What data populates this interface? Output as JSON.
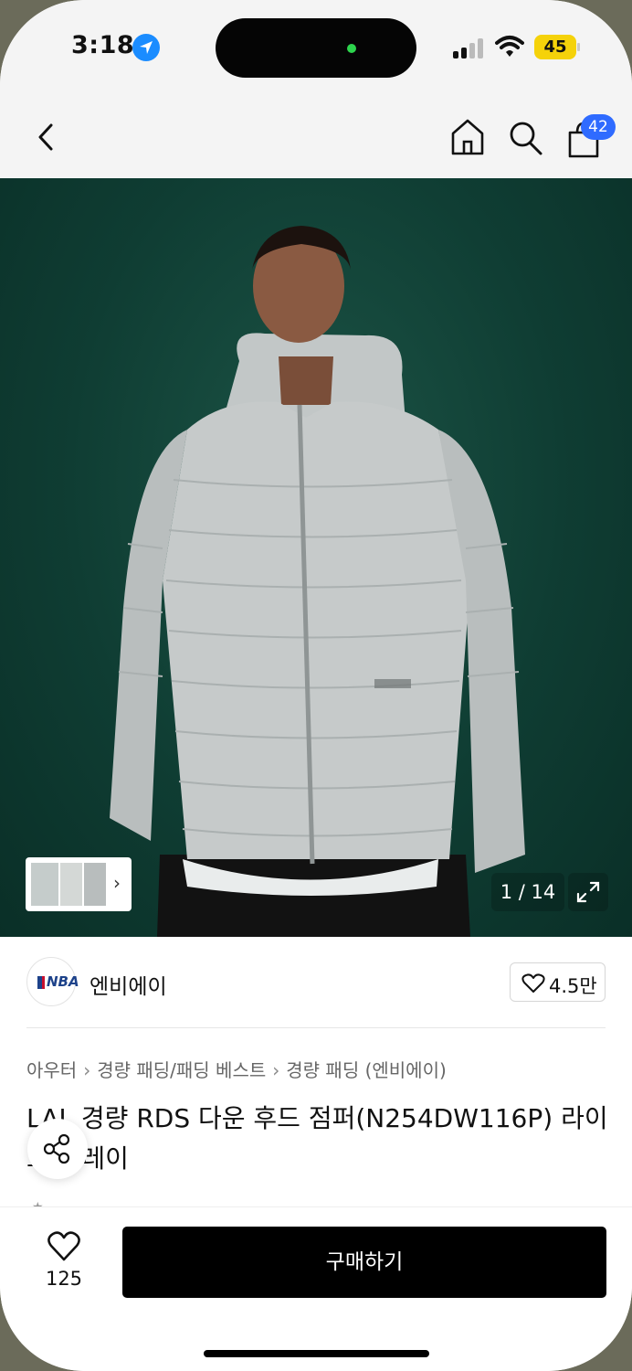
{
  "status_bar": {
    "time": "3:18",
    "battery": "45"
  },
  "nav": {
    "cart_count": "42"
  },
  "gallery": {
    "counter": "1 / 14"
  },
  "brand": {
    "name": "엔비에이",
    "logo_text": "NBA",
    "likes": "4.5만"
  },
  "breadcrumb": [
    "아우터",
    "경량 패딩/패딩 베스트",
    "경량 패딩 (엔비에이)"
  ],
  "product": {
    "title": "LAL 경량 RDS 다운 후드 점퍼(N254DW116P) 라이트 그레이"
  },
  "bottom_bar": {
    "wish_count": "125",
    "buy_label": "구매하기"
  },
  "colors": {
    "accent": "#2f6bff",
    "buy_button": "#000000",
    "hero_background": "#0f3d33"
  },
  "icons": [
    "location-arrow-icon",
    "back-icon",
    "home-icon",
    "search-icon",
    "shopping-bag-icon",
    "chevron-right-icon",
    "expand-icon",
    "heart-icon",
    "share-icon"
  ]
}
